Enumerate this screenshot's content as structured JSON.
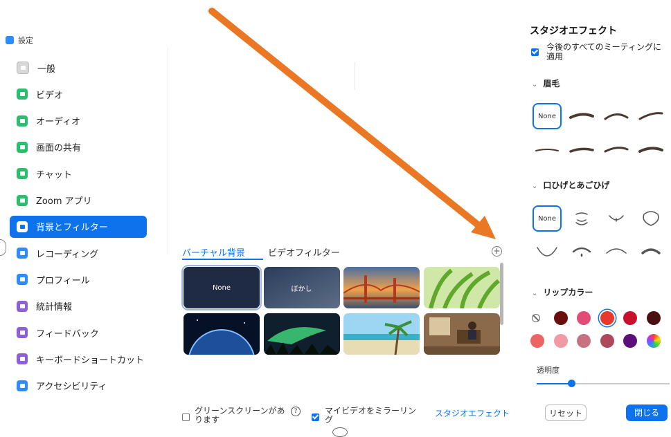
{
  "window": {
    "title": "設定"
  },
  "sidebar": {
    "items": [
      {
        "label": "一般",
        "icon": "gear-icon",
        "color": "#d8d8d8"
      },
      {
        "label": "ビデオ",
        "icon": "video-camera-icon",
        "color": "#2dbd6e"
      },
      {
        "label": "オーディオ",
        "icon": "headphones-icon",
        "color": "#2dbd6e"
      },
      {
        "label": "画面の共有",
        "icon": "share-screen-icon",
        "color": "#2dbd6e"
      },
      {
        "label": "チャット",
        "icon": "chat-bubble-icon",
        "color": "#2dbd6e"
      },
      {
        "label": "Zoom アプリ",
        "icon": "apps-icon",
        "color": "#2dbd6e"
      },
      {
        "label": "背景とフィルター",
        "icon": "background-icon",
        "color": "#ffffff",
        "active": true
      },
      {
        "label": "レコーディング",
        "icon": "record-icon",
        "color": "#2d8cff"
      },
      {
        "label": "プロフィール",
        "icon": "profile-icon",
        "color": "#2d8cff"
      },
      {
        "label": "統計情報",
        "icon": "statistics-icon",
        "color": "#8f5fd6"
      },
      {
        "label": "フィードバック",
        "icon": "feedback-icon",
        "color": "#8f5fd6"
      },
      {
        "label": "キーボードショートカット",
        "icon": "keyboard-icon",
        "color": "#8f5fd6"
      },
      {
        "label": "アクセシビリティ",
        "icon": "accessibility-icon",
        "color": "#2d8cff"
      }
    ]
  },
  "tabs": {
    "virtual_background": "バーチャル背景",
    "video_filter": "ビデオフィルター"
  },
  "backgrounds": [
    {
      "label": "None",
      "selected": true
    },
    {
      "label": "ぼかし"
    },
    {
      "label": ""
    },
    {
      "label": ""
    },
    {
      "label": ""
    },
    {
      "label": ""
    },
    {
      "label": ""
    },
    {
      "label": ""
    }
  ],
  "bottom": {
    "green_screen": "グリーンスクリーンがあります",
    "green_screen_checked": false,
    "mirror_video": "マイビデオをミラーリング",
    "mirror_video_checked": true,
    "studio_effects_link": "スタジオエフェクト"
  },
  "studio": {
    "title": "スタジオエフェクト",
    "apply_all": "今後のすべてのミーティングに適用",
    "apply_all_checked": true,
    "eyebrows_label": "眉毛",
    "beard_label": "口ひげとあごひげ",
    "lip_color_label": "リップカラー",
    "opacity_label": "透明度",
    "opacity_value": 0.25,
    "none_label": "None",
    "lip_colors": [
      "#6b0d0d",
      "#e24a77",
      "#e8372b",
      "#c8102e",
      "#4a1010",
      "#ec6464",
      "#f29aa3",
      "#c77281",
      "#b0485c",
      "#5c0f7a",
      "#ffb300"
    ],
    "selected_lip_color": "#e8372b",
    "reset_label": "リセット",
    "close_label": "閉じる"
  },
  "accent_color": "#0e72ed",
  "arrow_color": "#ea7724"
}
